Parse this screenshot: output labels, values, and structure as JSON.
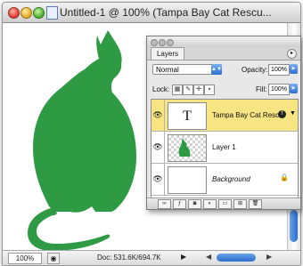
{
  "document": {
    "title": "Untitled-1 @ 100% (Tampa Bay Cat Rescu...",
    "zoom": "100%",
    "doc_size": "Doc: 531.6K/694.7K",
    "cat_color": "#2f9a44"
  },
  "layers_panel": {
    "tab_label": "Layers",
    "blend_mode": "Normal",
    "opacity_label": "Opacity:",
    "opacity_value": "100%",
    "lock_label": "Lock:",
    "fill_label": "Fill:",
    "fill_value": "100%",
    "layers": [
      {
        "name": "Tampa Bay Cat Resc...",
        "thumb_text": "T",
        "selected": true
      },
      {
        "name": "Layer 1",
        "selected": false
      },
      {
        "name": "Background",
        "selected": false
      }
    ],
    "selected_color": "#f7e483"
  }
}
